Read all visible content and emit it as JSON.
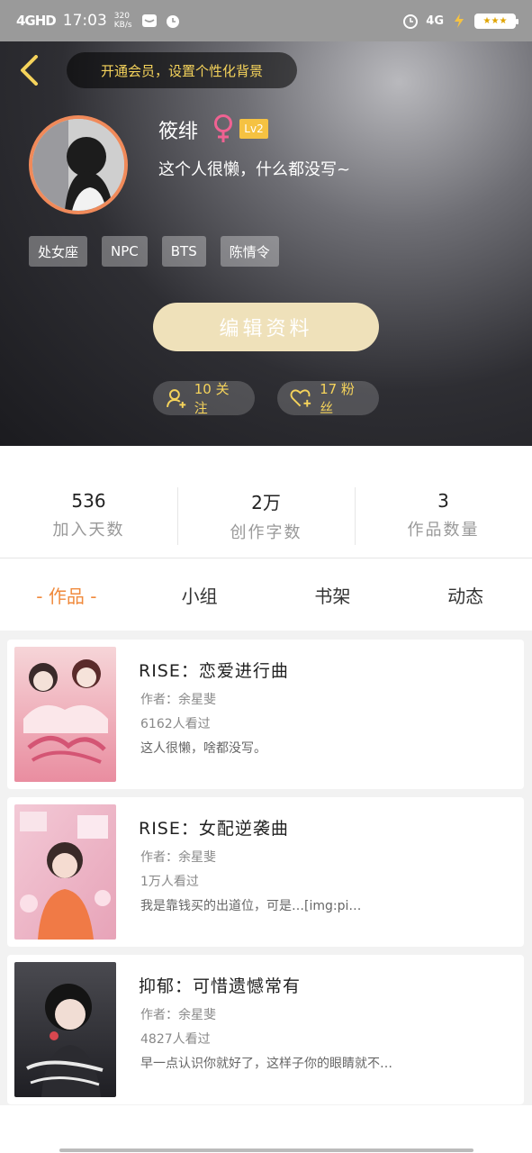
{
  "status_bar": {
    "signal": "4GHD",
    "time": "17:03",
    "net_speed": "320 KB/s",
    "network": "4G",
    "battery_stars": "★★★"
  },
  "header": {
    "vip_prompt": "开通会员，设置个性化背景",
    "username": "筱绯",
    "gender_symbol": "♀",
    "level": "Lv2",
    "bio": "这个人很懒，什么都没写~",
    "tags": [
      "处女座",
      "NPC",
      "BTS",
      "陈情令"
    ],
    "edit_button": "编辑资料",
    "following_label": "10 关注",
    "fans_label": "17 粉丝"
  },
  "stats": [
    {
      "value": "536",
      "label": "加入天数"
    },
    {
      "value": "2万",
      "label": "创作字数"
    },
    {
      "value": "3",
      "label": "作品数量"
    }
  ],
  "tabs": [
    "- 作品 -",
    "小组",
    "书架",
    "动态"
  ],
  "works": [
    {
      "title": "RISE：恋爱进行曲",
      "author": "作者：余星斐",
      "views": "6162人看过",
      "desc": "这人很懒，啥都没写。",
      "cover_colors": [
        "#f6d5d8",
        "#e98da0"
      ]
    },
    {
      "title": "RISE：女配逆袭曲",
      "author": "作者：余星斐",
      "views": "1万人看过",
      "desc": "我是靠钱买的出道位，可是…[img:pi…",
      "cover_colors": [
        "#f3c9d6",
        "#e7a3b8"
      ]
    },
    {
      "title": "抑郁：可惜遗憾常有",
      "author": "作者：余星斐",
      "views": "4827人看过",
      "desc": "早一点认识你就好了，这样子你的眼睛就不…",
      "cover_colors": [
        "#4a4a50",
        "#1f1f24"
      ]
    }
  ],
  "colors": {
    "accent": "#f08a3c",
    "gold": "#f5d35b",
    "avatar_border": "#f08a5a"
  }
}
